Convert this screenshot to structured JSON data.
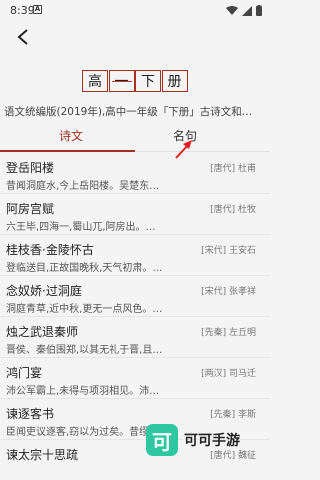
{
  "status_bar": {
    "time": "8:39",
    "notification_icon": "A"
  },
  "book_title": {
    "chars": [
      "高",
      "一",
      "下",
      "册"
    ]
  },
  "subtitle": "语文统编版(2019年),高中一年级「下册」古诗文和…",
  "tabs": [
    {
      "label": "诗文",
      "active": true
    },
    {
      "label": "名句",
      "active": false
    }
  ],
  "items": [
    {
      "title": "登岳阳楼",
      "author": "[唐代] 杜甫",
      "excerpt": "昔闻洞庭水,今上岳阳楼。吴楚东…"
    },
    {
      "title": "阿房宫赋",
      "author": "[唐代] 杜牧",
      "excerpt": "六王毕,四海一,蜀山兀,阿房出。…"
    },
    {
      "title": "桂枝香·金陵怀古",
      "author": "[宋代] 王安石",
      "excerpt": "登临送目,正故国晚秋,天气初肃。…"
    },
    {
      "title": "念奴娇·过洞庭",
      "author": "[宋代] 张孝祥",
      "excerpt": "洞庭青草,近中秋,更无一点风色。…"
    },
    {
      "title": "烛之武退秦师",
      "author": "[先秦] 左丘明",
      "excerpt": "晋侯、秦伯围郑,以其无礼于晋,且…"
    },
    {
      "title": "鸿门宴",
      "author": "[两汉] 司马迁",
      "excerpt": "沛公军霸上,未得与项羽相见。沛…"
    },
    {
      "title": "谏逐客书",
      "author": "[先秦] 李斯",
      "excerpt": "臣闻吏议逐客,窃以为过矣。昔缪…"
    },
    {
      "title": "谏太宗十思疏",
      "author": "[唐代] 魏征",
      "excerpt": ""
    }
  ],
  "watermark": {
    "logo": "可",
    "text": "可可手游"
  },
  "colors": {
    "accent": "#a13224",
    "arrow": "#e02020",
    "watermark": "#2ec7a2"
  }
}
